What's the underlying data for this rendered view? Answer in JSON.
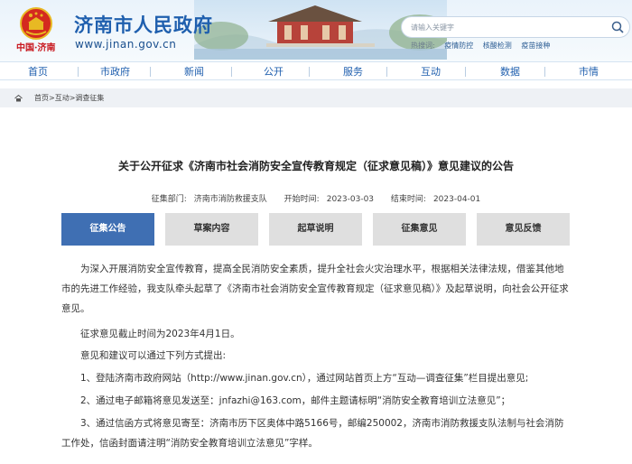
{
  "header": {
    "site_title": "济南市人民政府",
    "site_url": "www.jinan.gov.cn",
    "city_logo_text": "中国·济南",
    "search_placeholder": "请输入关键字",
    "hot_label": "热搜词:",
    "hot_words": [
      "疫情防控",
      "核酸检测",
      "疫苗接种"
    ]
  },
  "nav": [
    "首页",
    "市政府",
    "新闻",
    "公开",
    "服务",
    "互动",
    "数据",
    "市情"
  ],
  "breadcrumb": {
    "home": "首页",
    "sep": ">",
    "level2": "互动",
    "level3": "调查征集"
  },
  "article": {
    "title": "关于公开征求《济南市社会消防安全宣传教育规定（征求意见稿）》意见建议的公告",
    "department_label": "征集部门:",
    "department": "济南市消防救援支队",
    "start_label": "开始时间:",
    "start_date": "2023-03-03",
    "end_label": "结束时间:",
    "end_date": "2023-04-01"
  },
  "tabs": [
    "征集公告",
    "草案内容",
    "起草说明",
    "征集意见",
    "意见反馈"
  ],
  "content": {
    "p1": "为深入开展消防安全宣传教育，提高全民消防安全素质，提升全社会火灾治理水平，根据相关法律法规，借鉴其他地市的先进工作经验，我支队牵头起草了《济南市社会消防安全宣传教育规定（征求意见稿）》及起草说明，向社会公开征求意见。",
    "p2": "征求意见截止时间为2023年4月1日。",
    "p3": "意见和建议可以通过下列方式提出:",
    "p4": "1、登陆济南市政府网站（http://www.jinan.gov.cn），通过网站首页上方“互动—调查征集”栏目提出意见;",
    "p5": "2、通过电子邮箱将意见发送至：jnfazhi@163.com，邮件主题请标明“消防安全教育培训立法意见”；",
    "p6": "3、通过信函方式将意见寄至：济南市历下区奥体中路5166号，邮编250002，济南市消防救援支队法制与社会消防工作处，信函封面请注明“消防安全教育培训立法意见”字样。"
  },
  "colors": {
    "brand_blue": "#1f5fae",
    "tab_active": "#3f6fb3",
    "tab_inactive": "#dfdfdf",
    "logo_red": "#c8161d"
  },
  "icons": {
    "emblem": "national-emblem-icon",
    "search": "search-icon",
    "home": "home-icon"
  }
}
